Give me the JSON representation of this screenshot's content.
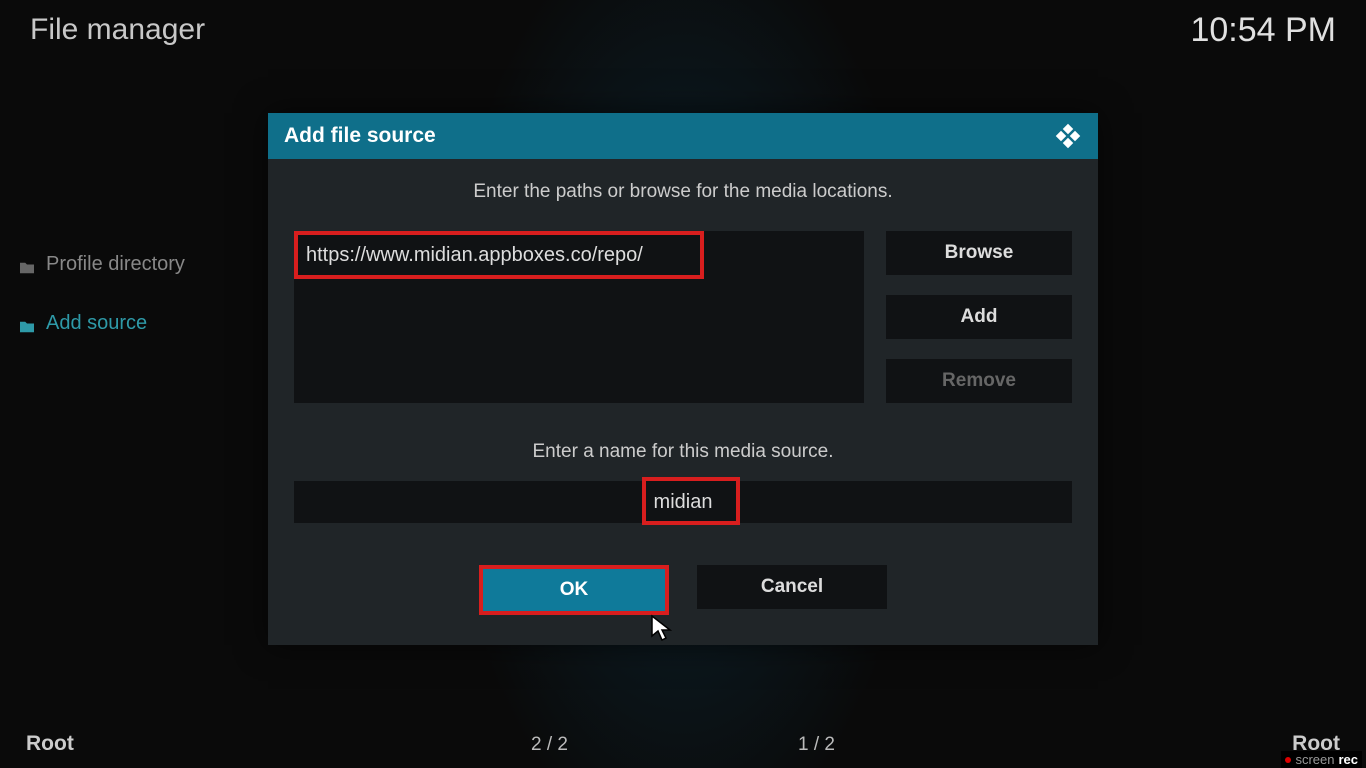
{
  "header": {
    "title": "File manager",
    "time": "10:54 PM"
  },
  "sidebar": {
    "items": [
      {
        "label": "Profile directory"
      },
      {
        "label": "Add source"
      }
    ]
  },
  "dialog": {
    "title": "Add file source",
    "instruction": "Enter the paths or browse for the media locations.",
    "path": "https://www.midian.appboxes.co/repo/",
    "browse_label": "Browse",
    "add_label": "Add",
    "remove_label": "Remove",
    "instruction2": "Enter a name for this media source.",
    "name": "midian",
    "ok_label": "OK",
    "cancel_label": "Cancel"
  },
  "footer": {
    "left": "Root",
    "right": "Root",
    "counter_left": "2 / 2",
    "counter_right": "1 / 2"
  },
  "watermark": {
    "brand_a": "screen",
    "brand_b": "rec"
  }
}
